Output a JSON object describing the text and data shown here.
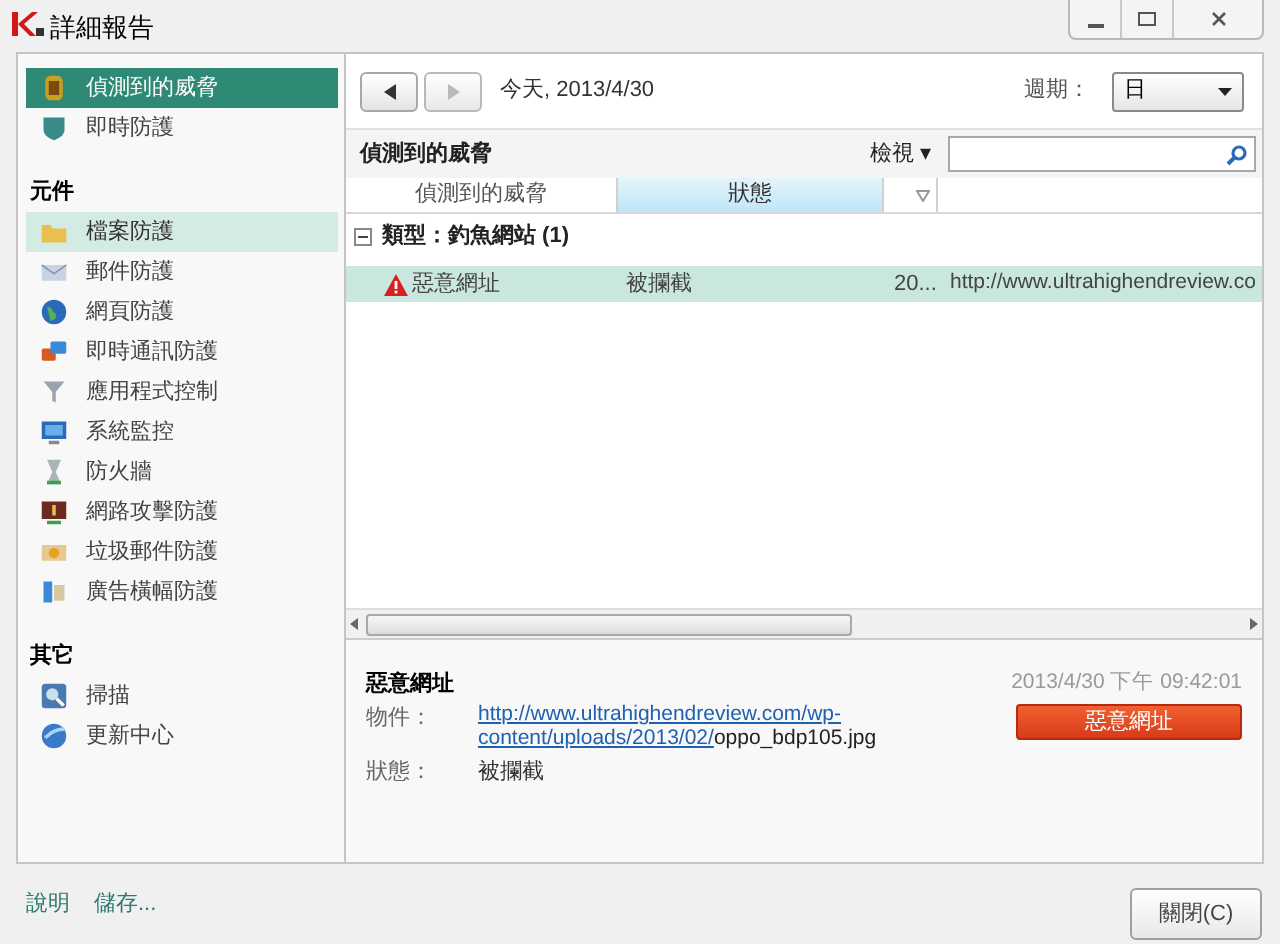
{
  "window": {
    "title": "詳細報告"
  },
  "sidebar": {
    "top_items": [
      {
        "label": "偵測到的威脅",
        "selected": true,
        "hovered": false
      },
      {
        "label": "即時防護",
        "selected": false,
        "hovered": false
      }
    ],
    "sections": [
      {
        "title": "元件",
        "items": [
          {
            "label": "檔案防護",
            "selected": false,
            "hovered": true
          },
          {
            "label": "郵件防護",
            "selected": false,
            "hovered": false
          },
          {
            "label": "網頁防護",
            "selected": false,
            "hovered": false
          },
          {
            "label": "即時通訊防護",
            "selected": false,
            "hovered": false
          },
          {
            "label": "應用程式控制",
            "selected": false,
            "hovered": false
          },
          {
            "label": "系統監控",
            "selected": false,
            "hovered": false
          },
          {
            "label": "防火牆",
            "selected": false,
            "hovered": false
          },
          {
            "label": "網路攻擊防護",
            "selected": false,
            "hovered": false
          },
          {
            "label": "垃圾郵件防護",
            "selected": false,
            "hovered": false
          },
          {
            "label": "廣告橫幅防護",
            "selected": false,
            "hovered": false
          }
        ]
      },
      {
        "title": "其它",
        "items": [
          {
            "label": "掃描",
            "selected": false,
            "hovered": false
          },
          {
            "label": "更新中心",
            "selected": false,
            "hovered": false
          }
        ]
      }
    ]
  },
  "toolbar": {
    "date": "今天, 2013/4/30",
    "period_label": "週期：",
    "period_value": "日"
  },
  "table": {
    "title": "偵測到的威脅",
    "view_menu": "檢視 ▾",
    "columns": [
      {
        "label": "偵測到的威脅",
        "selected": false
      },
      {
        "label": "狀態",
        "selected": true
      },
      {
        "selected": false
      }
    ],
    "group": {
      "label": "類型：釣魚網站",
      "count": "(1)",
      "expanded": true
    },
    "rows": [
      {
        "name": "惡意網址",
        "status": "被攔截",
        "time": "20...",
        "url": "http://www.ultrahighendreview.co",
        "selected": true
      }
    ]
  },
  "details": {
    "title": "惡意網址",
    "timestamp": "2013/4/30 下午 09:42:01",
    "badge": "惡意網址",
    "object_label": "物件：",
    "object_link": [
      "http://www.ultrahighendreview.com/wp-",
      "content/uploads/2013/02/"
    ],
    "object_file": "oppo_bdp105.jpg",
    "status_label": "狀態：",
    "status_value": "被攔截"
  },
  "footer": {
    "links": [
      "說明",
      "儲存..."
    ],
    "close_button": "關閉(C)"
  }
}
